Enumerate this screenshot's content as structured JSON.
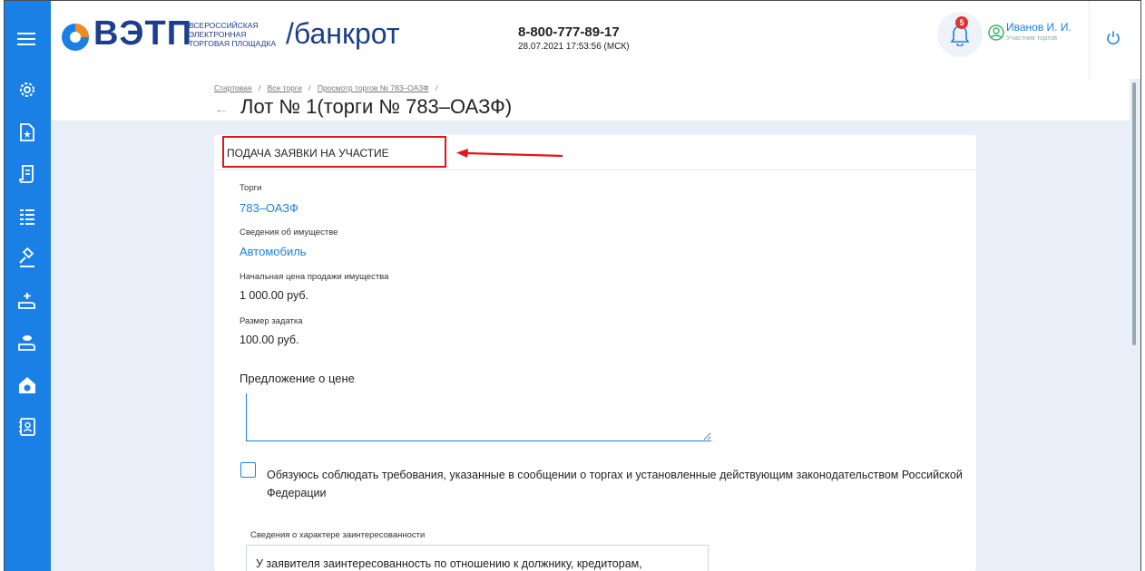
{
  "header": {
    "logo_text": "ВЭТП",
    "logo_sub": [
      "ВСЕРОССИЙСКАЯ",
      "ЭЛЕКТРОННАЯ",
      "ТОРГОВАЯ ПЛОЩАДКА"
    ],
    "section": "/банкрот",
    "phone": "8-800-777-89-17",
    "datetime": "28.07.2021 17:53:56 (МСК)",
    "notifications_count": "5",
    "user_name": "Иванов И. И.",
    "user_role": "Участник торгов"
  },
  "sidebar": {
    "items": [
      {
        "icon": "settings-icon"
      },
      {
        "icon": "document-star-icon"
      },
      {
        "icon": "scroll-icon"
      },
      {
        "icon": "list-icon"
      },
      {
        "icon": "gavel-icon"
      },
      {
        "icon": "hand-add-icon"
      },
      {
        "icon": "hand-coin-icon"
      },
      {
        "icon": "house-ruble-icon"
      },
      {
        "icon": "contact-card-icon"
      }
    ]
  },
  "breadcrumb": {
    "items": [
      "Стартовая",
      "Все торги",
      "Просмотр торгов № 783–ОАЗФ"
    ],
    "separator": "/"
  },
  "page_title": "Лот № 1(торги № 783–ОАЗФ)",
  "card": {
    "title": "ПОДАЧА ЗАЯВКИ НА УЧАСТИЕ",
    "fields": [
      {
        "label": "Торги",
        "value": "783–ОАЗФ",
        "link": true
      },
      {
        "label": "Сведения об имуществе",
        "value": "Автомобиль",
        "link": true
      },
      {
        "label": "Начальная цена продажи имущества",
        "value": "1 000.00 руб.",
        "link": false
      },
      {
        "label": "Размер задатка",
        "value": "100.00 руб.",
        "link": false
      }
    ],
    "price_offer_label": "Предложение о цене",
    "price_offer_value": "",
    "agreement_text": "Обязуюсь соблюдать требования, указанные в сообщении о торгах и установленные действующим законодательством Российской Федерации",
    "interest_label": "Сведения о характере заинтересованности",
    "interest_text": "У заявителя заинтересованность по отношению к должнику, кредиторам,"
  },
  "colors": {
    "brand": "#1a80e5",
    "logo": "#1d3e8d",
    "annotation": "#e3151a"
  }
}
